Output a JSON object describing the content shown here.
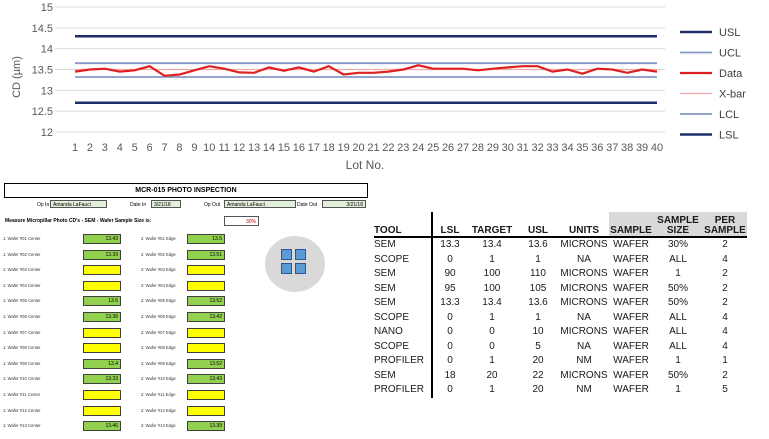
{
  "chart_data": {
    "type": "line",
    "title": "",
    "xlabel": "Lot No.",
    "ylabel": "CD (µm)",
    "ylim": [
      12,
      15
    ],
    "yticks": [
      12,
      12.5,
      13,
      13.5,
      14,
      14.5,
      15
    ],
    "ytick_labels": [
      "12",
      "12.5",
      "13",
      "13.5",
      "14",
      "14.5",
      "15"
    ],
    "categories": [
      "1",
      "2",
      "3",
      "4",
      "5",
      "6",
      "7",
      "8",
      "9",
      "10",
      "11",
      "12",
      "13",
      "14",
      "15",
      "16",
      "17",
      "18",
      "19",
      "20",
      "21",
      "22",
      "23",
      "24",
      "25",
      "26",
      "27",
      "28",
      "29",
      "30",
      "31",
      "32",
      "33",
      "34",
      "35",
      "36",
      "37",
      "38",
      "39",
      "40"
    ],
    "series": [
      {
        "name": "USL",
        "color": "#1f2f6b",
        "values": [
          14.3,
          14.3,
          14.3,
          14.3,
          14.3,
          14.3,
          14.3,
          14.3,
          14.3,
          14.3,
          14.3,
          14.3,
          14.3,
          14.3,
          14.3,
          14.3,
          14.3,
          14.3,
          14.3,
          14.3,
          14.3,
          14.3,
          14.3,
          14.3,
          14.3,
          14.3,
          14.3,
          14.3,
          14.3,
          14.3,
          14.3,
          14.3,
          14.3,
          14.3,
          14.3,
          14.3,
          14.3,
          14.3,
          14.3,
          14.3
        ]
      },
      {
        "name": "UCL",
        "color": "#8497c8",
        "values": [
          13.65,
          13.65,
          13.65,
          13.65,
          13.65,
          13.65,
          13.65,
          13.65,
          13.65,
          13.65,
          13.65,
          13.65,
          13.65,
          13.65,
          13.65,
          13.65,
          13.65,
          13.65,
          13.65,
          13.65,
          13.65,
          13.65,
          13.65,
          13.65,
          13.65,
          13.65,
          13.65,
          13.65,
          13.65,
          13.65,
          13.65,
          13.65,
          13.65,
          13.65,
          13.65,
          13.65,
          13.65,
          13.65,
          13.65,
          13.65
        ]
      },
      {
        "name": "Data",
        "color": "#e02020",
        "values": [
          13.45,
          13.5,
          13.52,
          13.45,
          13.48,
          13.58,
          13.35,
          13.38,
          13.48,
          13.58,
          13.52,
          13.43,
          13.42,
          13.55,
          13.47,
          13.55,
          13.45,
          13.58,
          13.38,
          13.42,
          13.42,
          13.45,
          13.5,
          13.6,
          13.52,
          13.52,
          13.52,
          13.48,
          13.52,
          13.55,
          13.58,
          13.58,
          13.45,
          13.5,
          13.4,
          13.52,
          13.5,
          13.42,
          13.5,
          13.45
        ]
      },
      {
        "name": "X-bar",
        "color": "#f4a7a7",
        "values": [
          13.5,
          13.5,
          13.5,
          13.5,
          13.5,
          13.5,
          13.5,
          13.5,
          13.5,
          13.5,
          13.5,
          13.5,
          13.5,
          13.5,
          13.5,
          13.5,
          13.5,
          13.5,
          13.5,
          13.5,
          13.5,
          13.5,
          13.5,
          13.5,
          13.5,
          13.5,
          13.5,
          13.5,
          13.5,
          13.5,
          13.5,
          13.5,
          13.5,
          13.5,
          13.5,
          13.5,
          13.5,
          13.5,
          13.5,
          13.5
        ]
      },
      {
        "name": "LCL",
        "color": "#8497c8",
        "values": [
          13.32,
          13.32,
          13.32,
          13.32,
          13.32,
          13.32,
          13.32,
          13.32,
          13.32,
          13.32,
          13.32,
          13.32,
          13.32,
          13.32,
          13.32,
          13.32,
          13.32,
          13.32,
          13.32,
          13.32,
          13.32,
          13.32,
          13.32,
          13.32,
          13.32,
          13.32,
          13.32,
          13.32,
          13.32,
          13.32,
          13.32,
          13.32,
          13.32,
          13.32,
          13.32,
          13.32,
          13.32,
          13.32,
          13.32,
          13.32
        ]
      },
      {
        "name": "LSL",
        "color": "#1f2f6b",
        "values": [
          12.7,
          12.7,
          12.7,
          12.7,
          12.7,
          12.7,
          12.7,
          12.7,
          12.7,
          12.7,
          12.7,
          12.7,
          12.7,
          12.7,
          12.7,
          12.7,
          12.7,
          12.7,
          12.7,
          12.7,
          12.7,
          12.7,
          12.7,
          12.7,
          12.7,
          12.7,
          12.7,
          12.7,
          12.7,
          12.7,
          12.7,
          12.7,
          12.7,
          12.7,
          12.7,
          12.7,
          12.7,
          12.7,
          12.7,
          12.7
        ]
      }
    ],
    "grid": true,
    "legend_position": "right"
  },
  "form": {
    "title": "MCR-015 PHOTO INSPECTION",
    "op_in_label": "Op In",
    "op_in_value": "Amanda LaFauci",
    "date_in_label": "Date In",
    "date_in_value": "3/21/18",
    "op_out_label": "Op Out",
    "op_out_value": "Amanda LaFauci",
    "date_out_label": "Date Out",
    "date_out_value": "3/21/18",
    "measure_title": "Measure Micropillar Photo CD's - SEM - Wafer Sample Size is:",
    "sample_size": "30%",
    "rows": [
      {
        "center_label": "1: Wafer #01 Center",
        "center_value": "13.43",
        "center_status": "green",
        "edge_label": "2: Wafer #01 Edge",
        "edge_value": "13.5",
        "edge_status": "green"
      },
      {
        "center_label": "1: Wafer #02 Center",
        "center_value": "13.39",
        "center_status": "green",
        "edge_label": "2: Wafer #02 Edge",
        "edge_value": "13.51",
        "edge_status": "green"
      },
      {
        "center_label": "1: Wafer #03 Center",
        "center_value": "",
        "center_status": "yellow",
        "edge_label": "2: Wafer #03 Edge",
        "edge_value": "",
        "edge_status": "yellow"
      },
      {
        "center_label": "1: Wafer #04 Center",
        "center_value": "",
        "center_status": "yellow",
        "edge_label": "2: Wafer #04 Edge",
        "edge_value": "",
        "edge_status": "yellow"
      },
      {
        "center_label": "1: Wafer #05 Center",
        "center_value": "13.6",
        "center_status": "green",
        "edge_label": "2: Wafer #05 Edge",
        "edge_value": "13.52",
        "edge_status": "green"
      },
      {
        "center_label": "1: Wafer #06 Center",
        "center_value": "13.36",
        "center_status": "green",
        "edge_label": "2: Wafer #06 Edge",
        "edge_value": "13.42",
        "edge_status": "green"
      },
      {
        "center_label": "1: Wafer #07 Center",
        "center_value": "",
        "center_status": "yellow",
        "edge_label": "2: Wafer #07 Edge",
        "edge_value": "",
        "edge_status": "yellow"
      },
      {
        "center_label": "1: Wafer #08 Center",
        "center_value": "",
        "center_status": "yellow",
        "edge_label": "2: Wafer #08 Edge",
        "edge_value": "",
        "edge_status": "yellow"
      },
      {
        "center_label": "1: Wafer #09 Center",
        "center_value": "13.4",
        "center_status": "green",
        "edge_label": "2: Wafer #09 Edge",
        "edge_value": "13.52",
        "edge_status": "green"
      },
      {
        "center_label": "1: Wafer #10 Center",
        "center_value": "13.33",
        "center_status": "green",
        "edge_label": "2: Wafer #10 Edge",
        "edge_value": "13.43",
        "edge_status": "green"
      },
      {
        "center_label": "1: Wafer #11 Center",
        "center_value": "",
        "center_status": "yellow",
        "edge_label": "2: Wafer #11 Edge",
        "edge_value": "",
        "edge_status": "yellow"
      },
      {
        "center_label": "1: Wafer #12 Center",
        "center_value": "",
        "center_status": "yellow",
        "edge_label": "2: Wafer #12 Edge",
        "edge_value": "",
        "edge_status": "yellow"
      },
      {
        "center_label": "1: Wafer #13 Center",
        "center_value": "13.46",
        "center_status": "green",
        "edge_label": "2: Wafer #13 Edge",
        "edge_value": "13.39",
        "edge_status": "green"
      }
    ]
  },
  "tool_table": {
    "headers": {
      "tool": "TOOL",
      "lsl": "LSL",
      "target": "TARGET",
      "usl": "USL",
      "units": "UNITS",
      "sample": "SAMPLE",
      "sample_size": "SAMPLE SIZE",
      "per_sample": "PER SAMPLE"
    },
    "rows": [
      {
        "tool": "SEM",
        "lsl": "13.3",
        "target": "13.4",
        "usl": "13.6",
        "units": "MICRONS",
        "sample": "WAFER",
        "sample_size": "30%",
        "per_sample": "2"
      },
      {
        "tool": "SCOPE",
        "lsl": "0",
        "target": "1",
        "usl": "1",
        "units": "NA",
        "sample": "WAFER",
        "sample_size": "ALL",
        "per_sample": "4"
      },
      {
        "tool": "SEM",
        "lsl": "90",
        "target": "100",
        "usl": "110",
        "units": "MICRONS",
        "sample": "WAFER",
        "sample_size": "1",
        "per_sample": "2"
      },
      {
        "tool": "SEM",
        "lsl": "95",
        "target": "100",
        "usl": "105",
        "units": "MICRONS",
        "sample": "WAFER",
        "sample_size": "50%",
        "per_sample": "2"
      },
      {
        "tool": "SEM",
        "lsl": "13.3",
        "target": "13.4",
        "usl": "13.6",
        "units": "MICRONS",
        "sample": "WAFER",
        "sample_size": "50%",
        "per_sample": "2"
      },
      {
        "tool": "SCOPE",
        "lsl": "0",
        "target": "1",
        "usl": "1",
        "units": "NA",
        "sample": "WAFER",
        "sample_size": "ALL",
        "per_sample": "4"
      },
      {
        "tool": "NANO",
        "lsl": "0",
        "target": "0",
        "usl": "10",
        "units": "MICRONS",
        "sample": "WAFER",
        "sample_size": "ALL",
        "per_sample": "4"
      },
      {
        "tool": "SCOPE",
        "lsl": "0",
        "target": "0",
        "usl": "5",
        "units": "NA",
        "sample": "WAFER",
        "sample_size": "ALL",
        "per_sample": "4"
      },
      {
        "tool": "PROFILER",
        "lsl": "0",
        "target": "1",
        "usl": "20",
        "units": "NM",
        "sample": "WAFER",
        "sample_size": "1",
        "per_sample": "1"
      },
      {
        "tool": "SEM",
        "lsl": "18",
        "target": "20",
        "usl": "22",
        "units": "MICRONS",
        "sample": "WAFER",
        "sample_size": "50%",
        "per_sample": "2"
      },
      {
        "tool": "PROFILER",
        "lsl": "0",
        "target": "1",
        "usl": "20",
        "units": "NM",
        "sample": "WAFER",
        "sample_size": "1",
        "per_sample": "5"
      }
    ]
  }
}
